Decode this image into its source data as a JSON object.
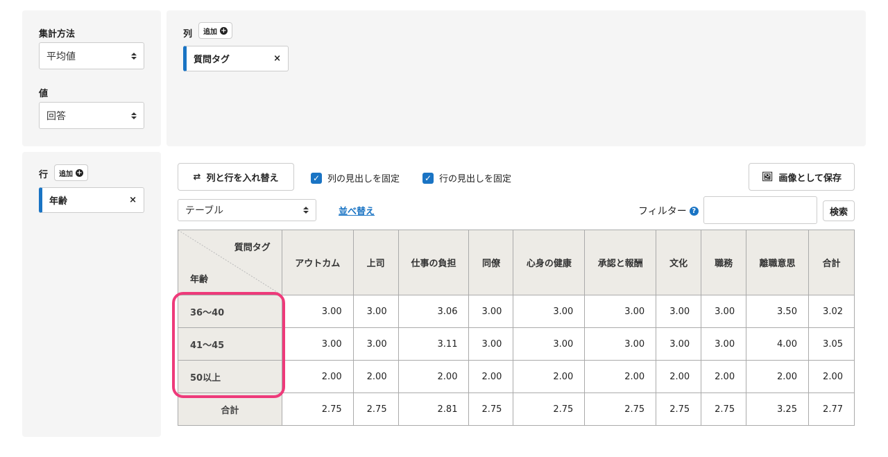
{
  "aggregation": {
    "method_label": "集計方法",
    "method_value": "平均値",
    "value_label": "値",
    "value_value": "回答"
  },
  "columns": {
    "label": "列",
    "add_label": "追加",
    "chip_label": "質問タグ",
    "remove": "×"
  },
  "rows": {
    "label": "行",
    "add_label": "追加",
    "chip_label": "年齢",
    "remove": "×"
  },
  "toolbar": {
    "swap_label": "列と行を入れ替え",
    "fix_col_header_label": "列の見出しを固定",
    "fix_row_header_label": "行の見出しを固定",
    "save_image_label": "画像として保存",
    "view_select_value": "テーブル",
    "sort_label": "並べ替え",
    "filter_label": "フィルター",
    "filter_value": "",
    "search_label": "検索"
  },
  "table": {
    "corner_col_label": "質問タグ",
    "corner_row_label": "年齢",
    "headers": [
      "アウトカム",
      "上司",
      "仕事の負担",
      "同僚",
      "心身の健康",
      "承認と報酬",
      "文化",
      "職務",
      "離職意思",
      "合計"
    ],
    "rows": [
      {
        "label": "36〜40",
        "values": [
          "3.00",
          "3.00",
          "3.06",
          "3.00",
          "3.00",
          "3.00",
          "3.00",
          "3.00",
          "3.50",
          "3.02"
        ]
      },
      {
        "label": "41〜45",
        "values": [
          "3.00",
          "3.00",
          "3.11",
          "3.00",
          "3.00",
          "3.00",
          "3.00",
          "3.00",
          "4.00",
          "3.05"
        ]
      },
      {
        "label": "50以上",
        "values": [
          "2.00",
          "2.00",
          "2.00",
          "2.00",
          "2.00",
          "2.00",
          "2.00",
          "2.00",
          "2.00",
          "2.00"
        ]
      },
      {
        "label": "合計",
        "values": [
          "2.75",
          "2.75",
          "2.81",
          "2.75",
          "2.75",
          "2.75",
          "2.75",
          "2.75",
          "3.25",
          "2.77"
        ]
      }
    ]
  },
  "colors": {
    "accent": "#1a74c4",
    "highlight": "#ee3a7a",
    "header_bg": "#edebe6"
  }
}
